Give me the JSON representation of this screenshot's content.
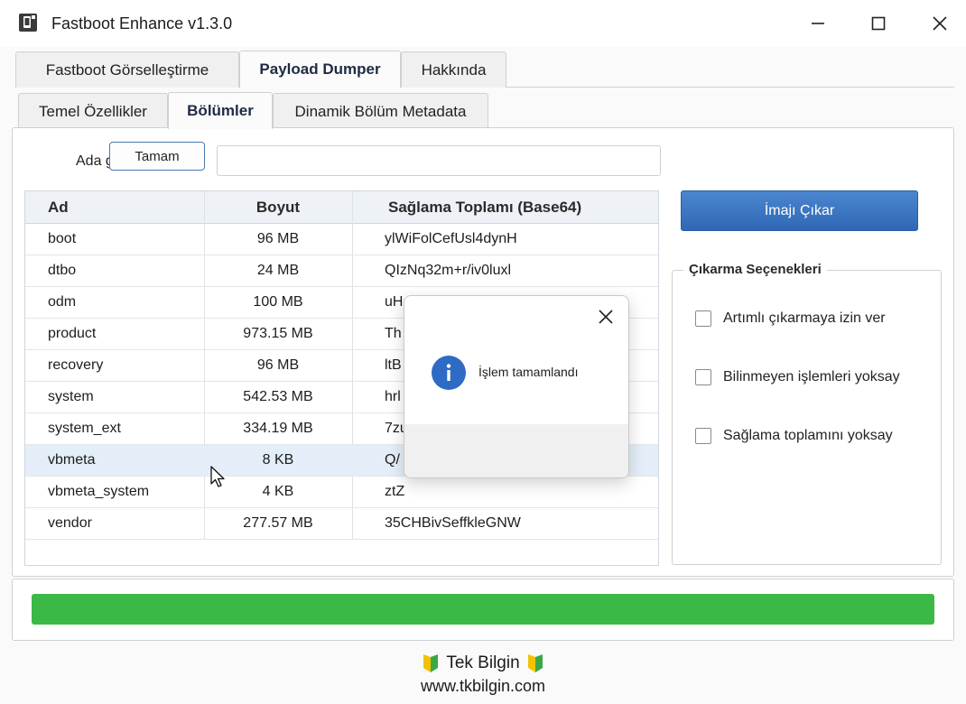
{
  "window": {
    "title": "Fastboot Enhance v1.3.0",
    "icon": "phone-app-icon",
    "controls": [
      "minimize-icon",
      "maximize-icon",
      "close-icon"
    ]
  },
  "tabs_main": [
    {
      "label": "Fastboot Görselleştirme",
      "active": false
    },
    {
      "label": "Payload Dumper",
      "active": true
    },
    {
      "label": "Hakkında",
      "active": false
    }
  ],
  "tabs_sub": [
    {
      "label": "Temel Özellikler",
      "active": false
    },
    {
      "label": "Bölümler",
      "active": true
    },
    {
      "label": "Dinamik Bölüm Metadata",
      "active": false
    }
  ],
  "filter": {
    "label": "Ada göre filtrele:",
    "value": "",
    "placeholder": ""
  },
  "table": {
    "columns": [
      "Ad",
      "Boyut",
      "Sağlama Toplamı (Base64)"
    ],
    "rows": [
      {
        "name": "boot",
        "size": "96 MB",
        "checksum": "ylWiFolCefUsl4dynH"
      },
      {
        "name": "dtbo",
        "size": "24 MB",
        "checksum": "QIzNq32m+r/iv0luxl"
      },
      {
        "name": "odm",
        "size": "100 MB",
        "checksum": "uH"
      },
      {
        "name": "product",
        "size": "973.15 MB",
        "checksum": "Th"
      },
      {
        "name": "recovery",
        "size": "96 MB",
        "checksum": "ltB"
      },
      {
        "name": "system",
        "size": "542.53 MB",
        "checksum": "hrl"
      },
      {
        "name": "system_ext",
        "size": "334.19 MB",
        "checksum": "7zu"
      },
      {
        "name": "vbmeta",
        "size": "8 KB",
        "checksum": "Q/",
        "selected": true
      },
      {
        "name": "vbmeta_system",
        "size": "4 KB",
        "checksum": "ztZ"
      },
      {
        "name": "vendor",
        "size": "277.57 MB",
        "checksum": "35CHBivSeffkleGNW"
      }
    ]
  },
  "extract_button": {
    "label": "İmajı Çıkar"
  },
  "options": {
    "title": "Çıkarma Seçenekleri",
    "items": [
      {
        "label": "Artımlı çıkarmaya izin ver",
        "checked": false
      },
      {
        "label": "Bilinmeyen işlemleri yoksay",
        "checked": false
      },
      {
        "label": "Sağlama toplamını yoksay",
        "checked": false
      }
    ]
  },
  "progress": {
    "value": 1.0
  },
  "footer": {
    "line1": "Tek Bilgin",
    "line2": "www.tkbilgin.com",
    "icon": "beginner-mark-icon"
  },
  "dialog": {
    "message": "İşlem tamamlandı",
    "ok_label": "Tamam",
    "icon": "info-icon"
  },
  "colors": {
    "accent_button": "#3a74c0",
    "progress": "#3cb847",
    "selected_row": "#e4eef8",
    "info_icon": "#2d6bc4"
  }
}
